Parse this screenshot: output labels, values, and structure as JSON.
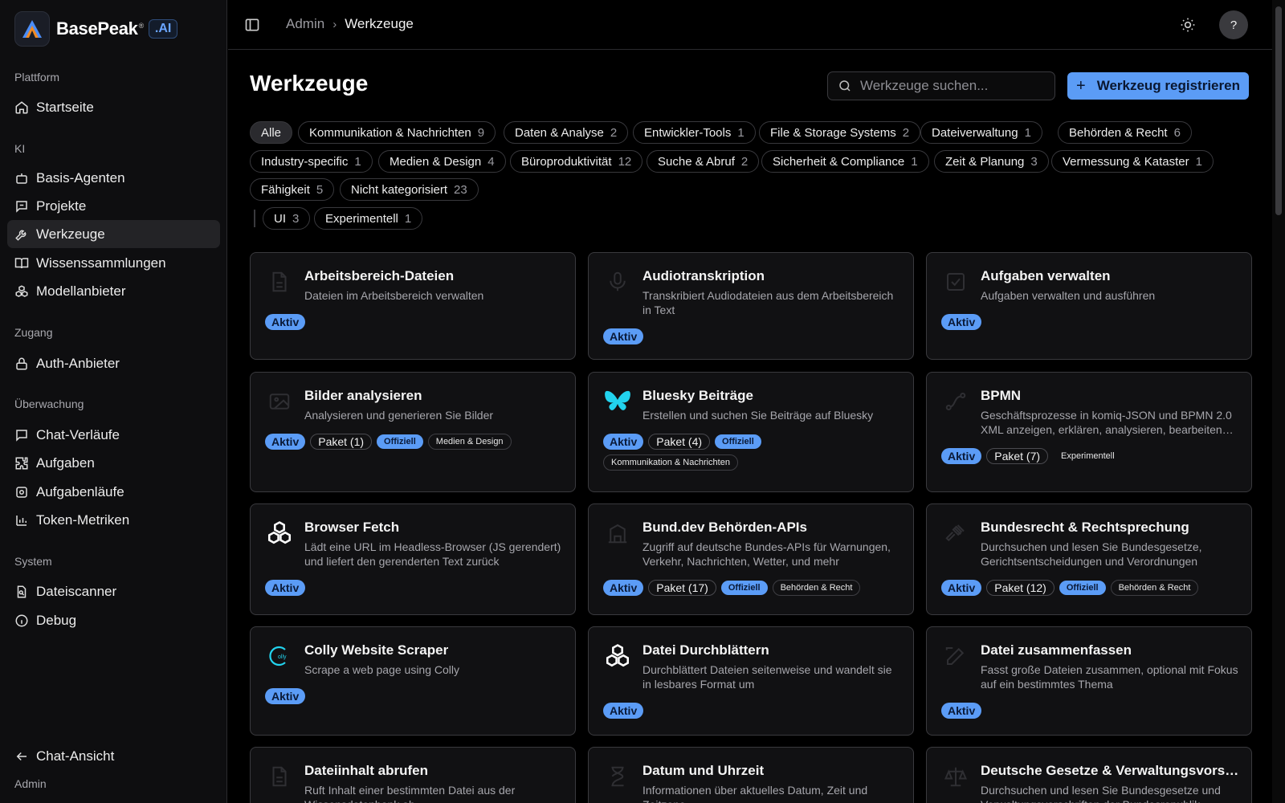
{
  "brand": {
    "name": "BasePeak",
    "reg": "®",
    "ai": ".AI"
  },
  "sidebar": {
    "sections": [
      {
        "label": "Plattform",
        "items": [
          {
            "label": "Startseite",
            "icon": "home-icon"
          }
        ]
      },
      {
        "label": "KI",
        "items": [
          {
            "label": "Basis-Agenten",
            "icon": "bot-icon"
          },
          {
            "label": "Projekte",
            "icon": "chat-project-icon"
          },
          {
            "label": "Werkzeuge",
            "icon": "wrench-icon",
            "active": true
          },
          {
            "label": "Wissenssammlungen",
            "icon": "book-icon"
          },
          {
            "label": "Modellanbieter",
            "icon": "cubes-icon"
          }
        ]
      },
      {
        "label": "Zugang",
        "items": [
          {
            "label": "Auth-Anbieter",
            "icon": "lock-icon"
          }
        ]
      },
      {
        "label": "Überwachung",
        "items": [
          {
            "label": "Chat-Verläufe",
            "icon": "message-icon"
          },
          {
            "label": "Aufgaben",
            "icon": "puzzle-icon"
          },
          {
            "label": "Aufgabenläufe",
            "icon": "cog-run-icon"
          },
          {
            "label": "Token-Metriken",
            "icon": "bar-chart-icon"
          }
        ]
      },
      {
        "label": "System",
        "items": [
          {
            "label": "Dateiscanner",
            "icon": "file-search-icon"
          },
          {
            "label": "Debug",
            "icon": "info-icon"
          }
        ]
      }
    ],
    "footer": {
      "chat_view": "Chat-Ansicht",
      "admin": "Admin"
    }
  },
  "header": {
    "breadcrumb": {
      "parent": "Admin",
      "sep": "›",
      "current": "Werkzeuge"
    },
    "avatar": "?"
  },
  "main": {
    "title": "Werkzeuge",
    "search_placeholder": "Werkzeuge suchen...",
    "register_label": "Werkzeug registrieren",
    "filters": [
      {
        "label": "Alle",
        "count": "",
        "active": true
      },
      {
        "label": "Kommunikation & Nachrichten",
        "count": "9"
      },
      {
        "label": "Daten & Analyse",
        "count": "2"
      },
      {
        "label": "Entwickler-Tools",
        "count": "1"
      },
      {
        "label": "File & Storage Systems",
        "count": "2"
      },
      {
        "label": "Dateiverwaltung",
        "count": "1"
      },
      {
        "label": "Behörden & Recht",
        "count": "6"
      },
      {
        "label": "Industry-specific",
        "count": "1"
      },
      {
        "label": "Medien & Design",
        "count": "4"
      },
      {
        "label": "Büroproduktivität",
        "count": "12"
      },
      {
        "label": "Suche & Abruf",
        "count": "2"
      },
      {
        "label": "Sicherheit & Compliance",
        "count": "1"
      },
      {
        "label": "Zeit & Planung",
        "count": "3"
      },
      {
        "label": "Vermessung & Kataster",
        "count": "1"
      },
      {
        "label": "Fähigkeit",
        "count": "5"
      },
      {
        "label": "Nicht kategorisiert",
        "count": "23"
      },
      {
        "label": "UI",
        "count": "3"
      },
      {
        "label": "Experimentell",
        "count": "1"
      }
    ],
    "cards": [
      {
        "title": "Arbeitsbereich-Dateien",
        "desc": "Dateien im Arbeitsbereich verwalten",
        "icon": "file-icon",
        "badges": [
          {
            "type": "active",
            "text": "Aktiv"
          }
        ]
      },
      {
        "title": "Audiotranskription",
        "desc": "Transkribiert Audiodateien aus dem Arbeitsbereich in Text",
        "icon": "mic-icon",
        "badges": [
          {
            "type": "active",
            "text": "Aktiv"
          }
        ]
      },
      {
        "title": "Aufgaben verwalten",
        "desc": "Aufgaben verwalten und ausführen",
        "icon": "checkbox-icon",
        "badges": [
          {
            "type": "active",
            "text": "Aktiv"
          }
        ]
      },
      {
        "title": "Bilder analysieren",
        "desc": "Analysieren und generieren Sie Bilder",
        "icon": "image-icon",
        "badges": [
          {
            "type": "active",
            "text": "Aktiv"
          },
          {
            "type": "pkg",
            "text": "Paket (1)"
          },
          {
            "type": "off",
            "text": "Offiziell"
          },
          {
            "type": "cat",
            "text": "Medien & Design"
          }
        ]
      },
      {
        "title": "Bluesky Beiträge",
        "desc": "Erstellen und suchen Sie Beiträge auf Bluesky",
        "icon": "butterfly-icon",
        "badges": [
          {
            "type": "active",
            "text": "Aktiv"
          },
          {
            "type": "pkg",
            "text": "Paket (4)"
          },
          {
            "type": "off",
            "text": "Offiziell"
          },
          {
            "type": "cat",
            "text": "Kommunikation & Nachrichten"
          }
        ]
      },
      {
        "title": "BPMN",
        "desc": "Geschäftsprozesse in komiq-JSON und BPMN 2.0 XML anzeigen, erklären, analysieren, bearbeiten und exportieren",
        "icon": "flow-icon",
        "badges": [
          {
            "type": "active",
            "text": "Aktiv"
          },
          {
            "type": "pkg",
            "text": "Paket (7)"
          },
          {
            "type": "plain",
            "text": "Experimentell"
          }
        ]
      },
      {
        "title": "Browser Fetch",
        "desc": "Lädt eine URL im Headless-Browser (JS gerendert) und liefert den gerenderten Text zurück",
        "icon": "cubes-icon",
        "badges": [
          {
            "type": "active",
            "text": "Aktiv"
          }
        ]
      },
      {
        "title": "Bund.dev Behörden-APIs",
        "desc": "Zugriff auf deutsche Bundes-APIs für Warnungen, Verkehr, Nachrichten, Wetter, und mehr",
        "icon": "building-icon",
        "badges": [
          {
            "type": "active",
            "text": "Aktiv"
          },
          {
            "type": "pkg",
            "text": "Paket (17)"
          },
          {
            "type": "off",
            "text": "Offiziell"
          },
          {
            "type": "cat",
            "text": "Behörden & Recht"
          }
        ]
      },
      {
        "title": "Bundesrecht & Rechtsprechung",
        "desc": "Durchsuchen und lesen Sie Bundesgesetze, Gerichtsentscheidungen und Verordnungen",
        "icon": "gavel-icon",
        "badges": [
          {
            "type": "active",
            "text": "Aktiv"
          },
          {
            "type": "pkg",
            "text": "Paket (12)"
          },
          {
            "type": "off",
            "text": "Offiziell"
          },
          {
            "type": "cat",
            "text": "Behörden & Recht"
          }
        ]
      },
      {
        "title": "Colly Website Scraper",
        "desc": "Scrape a web page using Colly",
        "icon": "colly-logo-icon",
        "badges": [
          {
            "type": "active",
            "text": "Aktiv"
          }
        ]
      },
      {
        "title": "Datei Durchblättern",
        "desc": "Durchblättert Dateien seitenweise und wandelt sie in lesbares Format um",
        "icon": "cubes-icon",
        "badges": [
          {
            "type": "active",
            "text": "Aktiv"
          }
        ]
      },
      {
        "title": "Datei zusammenfassen",
        "desc": "Fasst große Dateien zusammen, optional mit Fokus auf ein bestimmtes Thema",
        "icon": "edit-icon",
        "badges": [
          {
            "type": "active",
            "text": "Aktiv"
          }
        ]
      },
      {
        "title": "Dateiinhalt abrufen",
        "desc": "Ruft Inhalt einer bestimmten Datei aus der Wissensdatenbank ab",
        "icon": "file-icon",
        "badges": []
      },
      {
        "title": "Datum und Uhrzeit",
        "desc": "Informationen über aktuelles Datum, Zeit und Zeitzone",
        "icon": "hourglass-icon",
        "badges": []
      },
      {
        "title": "Deutsche Gesetze & Verwaltungsvorschriften",
        "desc": "Durchsuchen und lesen Sie Bundesgesetze und Verwaltungsvorschriften der Bundesrepublik",
        "icon": "scale-icon",
        "badges": []
      }
    ]
  }
}
